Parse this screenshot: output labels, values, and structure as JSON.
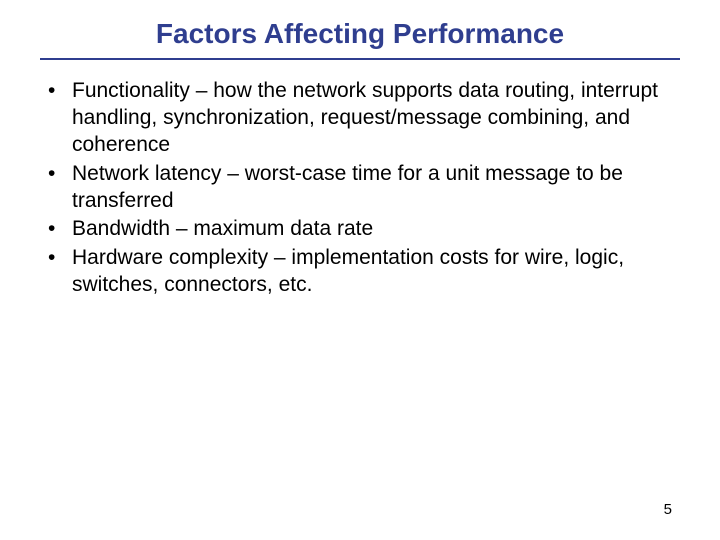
{
  "title": "Factors Affecting Performance",
  "bullets": [
    "Functionality – how the network supports data routing, interrupt handling, synchronization, request/message combining, and coherence",
    "Network latency – worst-case time for a unit message to be transferred",
    "Bandwidth – maximum data rate",
    "Hardware complexity – implementation costs for wire, logic, switches, connectors, etc."
  ],
  "page_number": "5"
}
